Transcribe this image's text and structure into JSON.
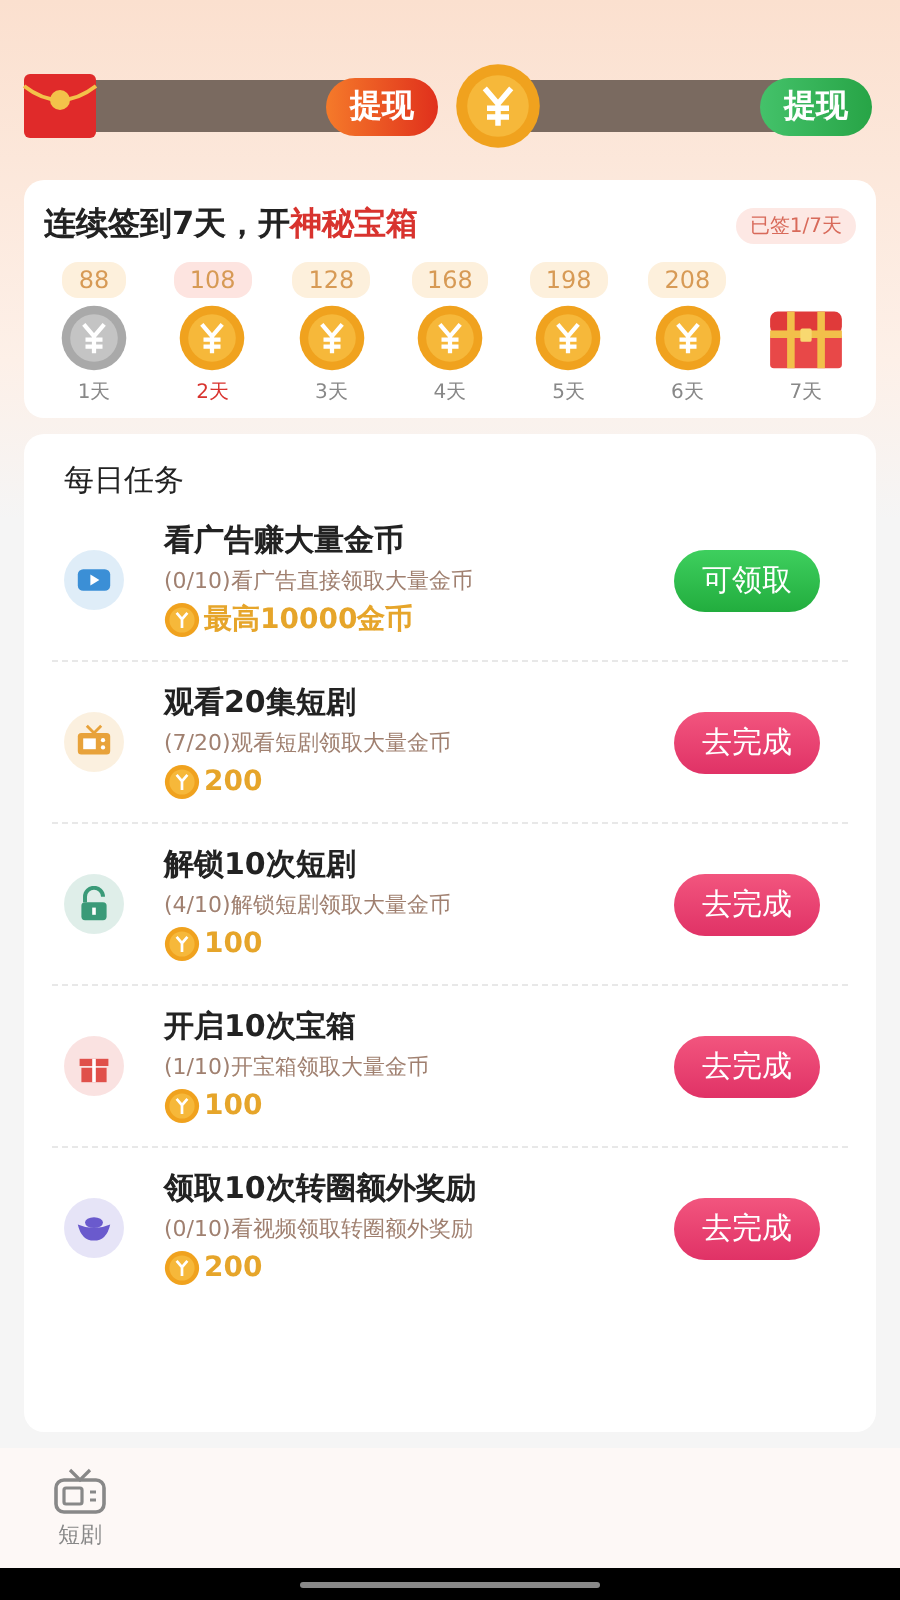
{
  "wallets": [
    {
      "kind": "cash",
      "button": "提现"
    },
    {
      "kind": "coin",
      "button": "提现"
    }
  ],
  "checkin": {
    "title": "连续签到7天，开**神秘宝箱**",
    "badge": "已签1/7天",
    "days": [
      {
        "kind": "coin",
        "reward": "88",
        "label": "1天",
        "claimed": true,
        "selected": false
      },
      {
        "kind": "coin",
        "reward": "108",
        "label": "2天",
        "claimed": false,
        "selected": true
      },
      {
        "kind": "coin",
        "reward": "128",
        "label": "3天",
        "claimed": false,
        "selected": false
      },
      {
        "kind": "coin",
        "reward": "168",
        "label": "4天",
        "claimed": false,
        "selected": false
      },
      {
        "kind": "coin",
        "reward": "198",
        "label": "5天",
        "claimed": false,
        "selected": false
      },
      {
        "kind": "coin",
        "reward": "208",
        "label": "6天",
        "claimed": false,
        "selected": false
      },
      {
        "kind": "chest",
        "label": "7天",
        "claimed": false,
        "selected": false
      }
    ]
  },
  "tasks": {
    "title": "每日任务",
    "items": [
      {
        "kind": "play",
        "color": "#3b8fd6",
        "title": "看广告赚大量金币",
        "desc": "(0/10)看广告直接领取大量金币",
        "reward": "最高10000金币",
        "button": "可领取",
        "claimable": true
      },
      {
        "kind": "tv",
        "color": "#e8a23a",
        "title": "观看20集短剧",
        "desc": "(7/20)观看短剧领取大量金币",
        "reward": "200",
        "button": "去完成",
        "claimable": false
      },
      {
        "kind": "lock",
        "color": "#3a9a78",
        "title": "解锁10次短剧",
        "desc": "(4/10)解锁短剧领取大量金币",
        "reward": "100",
        "button": "去完成",
        "claimable": false
      },
      {
        "kind": "gift",
        "color": "#e0504a",
        "title": "开启10次宝箱",
        "desc": "(1/10)开宝箱领取大量金币",
        "reward": "100",
        "button": "去完成",
        "claimable": false
      },
      {
        "kind": "ingot",
        "color": "#6a5acd",
        "title": "领取10次转圈额外奖励",
        "desc": "(0/10)看视频领取转圈额外奖励",
        "reward": "200",
        "button": "去完成",
        "claimable": false
      }
    ]
  },
  "nav": [
    {
      "label": "短剧",
      "selected": false
    }
  ]
}
